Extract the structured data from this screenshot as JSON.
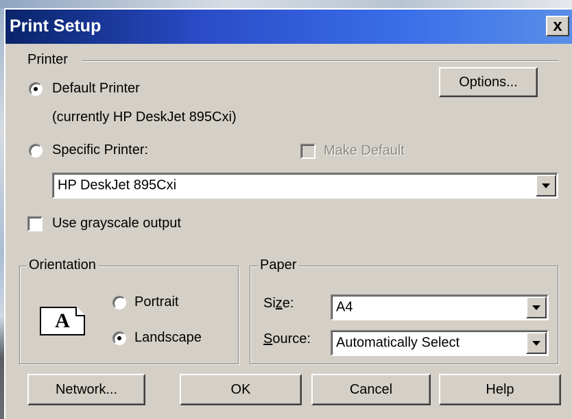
{
  "dialog": {
    "title": "Print Setup",
    "close_label": "x"
  },
  "printer": {
    "section_label": "Printer",
    "default_printer_label": "Default Printer",
    "default_printer_selected": true,
    "current_printer_note": "(currently HP DeskJet 895Cxi)",
    "specific_printer_label": "Specific Printer:",
    "specific_printer_selected": false,
    "make_default_label": "Make Default",
    "make_default_checked": false,
    "make_default_enabled": false,
    "printer_select_value": "HP DeskJet 895Cxi",
    "grayscale_label": "Use grayscale output",
    "grayscale_checked": false,
    "options_button": "Options..."
  },
  "orientation": {
    "group_label": "Orientation",
    "icon_letter": "A",
    "portrait_label": "Portrait",
    "portrait_selected": false,
    "landscape_label": "Landscape",
    "landscape_selected": true
  },
  "paper": {
    "group_label": "Paper",
    "size_label_pre": "Si",
    "size_label_u": "z",
    "size_label_post": "e:",
    "size_value": "A4",
    "source_label_u": "S",
    "source_label_post": "ource:",
    "source_value": "Automatically Select"
  },
  "buttons": {
    "network": "Network...",
    "ok": "OK",
    "cancel": "Cancel",
    "help": "Help"
  }
}
